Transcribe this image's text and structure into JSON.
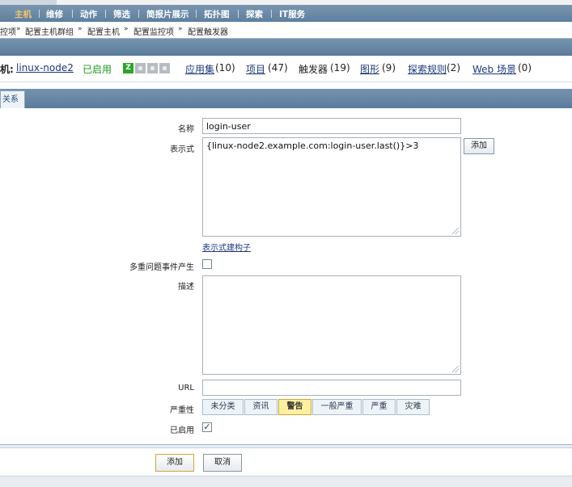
{
  "nav": {
    "items": [
      {
        "label": "主机",
        "active": true
      },
      {
        "label": "维修",
        "active": false
      },
      {
        "label": "动作",
        "active": false
      },
      {
        "label": "筛选",
        "active": false
      },
      {
        "label": "简报片展示",
        "active": false
      },
      {
        "label": "拓扑图",
        "active": false
      },
      {
        "label": "探索",
        "active": false
      },
      {
        "label": "IT服务",
        "active": false
      }
    ]
  },
  "breadcrumb": [
    "控项",
    "配置主机群组",
    "配置主机",
    "配置监控项",
    "配置触发器"
  ],
  "host": {
    "label": "机:",
    "name": "linux-node2",
    "status": "已启用",
    "availability": [
      "Z",
      "SNMP",
      "JMX",
      "IPMI"
    ],
    "links": [
      {
        "label": "应用集",
        "count": "(10)",
        "link": true
      },
      {
        "label": "项目",
        "count": "(47)",
        "link": true
      },
      {
        "label": "触发器",
        "count": "(19)",
        "link": false
      },
      {
        "label": "图形",
        "count": "(9)",
        "link": true
      },
      {
        "label": "探索规则",
        "count": "(2)",
        "link": true
      },
      {
        "label": "Web 场景",
        "count": "(0)",
        "link": true
      }
    ]
  },
  "tab": {
    "label": "关系"
  },
  "form": {
    "name_label": "名称",
    "name_value": "login-user",
    "expression_label": "表示式",
    "expression_value": "{linux-node2.example.com:login-user.last()}>3",
    "add_expression_button": "添加",
    "expression_builder_link": "表示式建构子",
    "multiple_events_label": "多重问题事件产生",
    "multiple_events_checked": false,
    "description_label": "描述",
    "description_value": "",
    "url_label": "URL",
    "url_value": "",
    "severity_label": "严重性",
    "severities": [
      {
        "label": "未分类",
        "selected": false
      },
      {
        "label": "资讯",
        "selected": false
      },
      {
        "label": "警告",
        "selected": true
      },
      {
        "label": "一般严重",
        "selected": false
      },
      {
        "label": "严重",
        "selected": false
      },
      {
        "label": "灾难",
        "selected": false
      }
    ],
    "enabled_label": "已启用",
    "enabled_checked": true,
    "checkmark": "✓"
  },
  "footer": {
    "add_button": "添加",
    "cancel_button": "取消"
  },
  "colors": {
    "accent": "#5a7c9b",
    "selected_severity": "#ffef9e",
    "status_green": "#1a9b1a",
    "link": "#1d3a7a"
  }
}
